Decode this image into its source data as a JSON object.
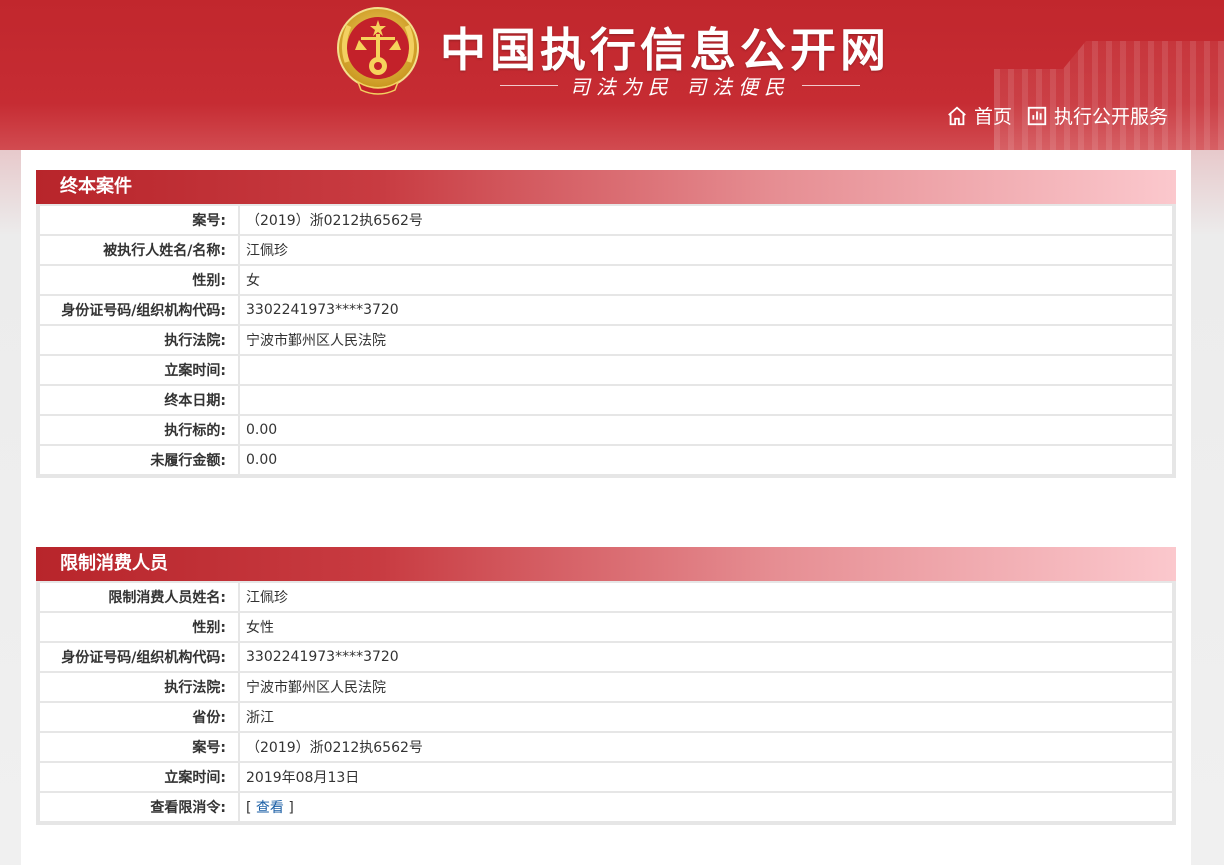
{
  "header": {
    "site_title": "中国执行信息公开网",
    "slogan": "司法为民   司法便民",
    "nav": [
      {
        "label": "首页",
        "icon": "home-icon"
      },
      {
        "label": "执行公开服务",
        "icon": "chart-icon"
      }
    ]
  },
  "sections": [
    {
      "title": "终本案件",
      "rows": [
        {
          "label": "案号:",
          "value": "（2019）浙0212执6562号"
        },
        {
          "label": "被执行人姓名/名称:",
          "value": "江佩珍"
        },
        {
          "label": "性别:",
          "value": "女"
        },
        {
          "label": "身份证号码/组织机构代码:",
          "value": "3302241973****3720"
        },
        {
          "label": "执行法院:",
          "value": "宁波市鄞州区人民法院"
        },
        {
          "label": "立案时间:",
          "value": ""
        },
        {
          "label": "终本日期:",
          "value": ""
        },
        {
          "label": "执行标的:",
          "value": "0.00"
        },
        {
          "label": "未履行金额:",
          "value": "0.00"
        }
      ]
    },
    {
      "title": "限制消费人员",
      "rows": [
        {
          "label": "限制消费人员姓名:",
          "value": "江佩珍"
        },
        {
          "label": "性别:",
          "value": "女性"
        },
        {
          "label": "身份证号码/组织机构代码:",
          "value": "3302241973****3720"
        },
        {
          "label": "执行法院:",
          "value": "宁波市鄞州区人民法院"
        },
        {
          "label": "省份:",
          "value": "浙江"
        },
        {
          "label": "案号:",
          "value": "（2019）浙0212执6562号"
        },
        {
          "label": "立案时间:",
          "value": "2019年08月13日"
        },
        {
          "label": "查看限消令:",
          "value_prefix": "[ ",
          "link": "查看",
          "value_suffix": " ]"
        }
      ]
    }
  ],
  "colors": {
    "header_red": "#c1272d",
    "section_header_start": "#b8252b",
    "section_header_end": "#fbc8cd",
    "link": "#1a5ea5"
  }
}
